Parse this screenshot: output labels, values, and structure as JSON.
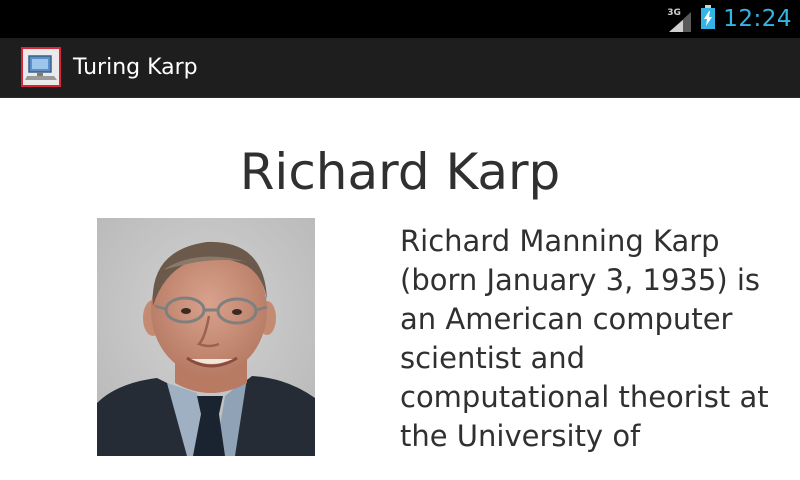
{
  "status_bar": {
    "network_type": "3G",
    "time": "12:24",
    "icons": [
      "signal-icon",
      "battery-charging-icon"
    ]
  },
  "action_bar": {
    "title": "Turing Karp",
    "icon": "app-icon"
  },
  "content": {
    "name": "Richard Karp",
    "bio": "Richard Manning Karp\n(born January 3, 1935) is\nan American computer\nscientist and\ncomputational theorist at\nthe University of",
    "portrait_icon": "portrait-photo"
  },
  "colors": {
    "status_bar_bg": "#000000",
    "action_bar_bg": "#1e1e1e",
    "clock": "#33b5e5",
    "body_text": "#303030",
    "app_icon_border": "#d8263b"
  }
}
